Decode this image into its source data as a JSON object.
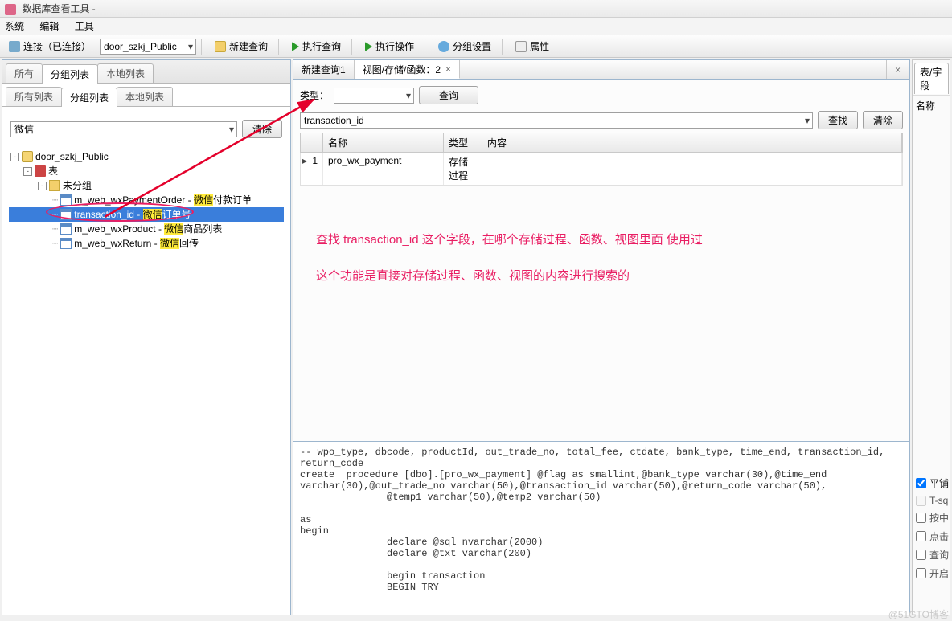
{
  "window": {
    "title": "数据库查看工具 -"
  },
  "menu": {
    "system": "系统",
    "edit": "编辑",
    "tools": "工具"
  },
  "toolbar": {
    "connect": "连接（已连接）",
    "db_selected": "door_szkj_Public",
    "new_query": "新建查询",
    "run_query": "执行查询",
    "run_op": "执行操作",
    "group_settings": "分组设置",
    "properties": "属性"
  },
  "left": {
    "top_tabs": {
      "all": "所有",
      "group": "分组列表",
      "local": "本地列表"
    },
    "inner_tabs": {
      "all": "所有列表",
      "group": "分组列表",
      "local": "本地列表"
    },
    "filter_value": "微信",
    "clear": "清除",
    "tree": {
      "db": "door_szkj_Public",
      "tables": "表",
      "ungrouped": "未分组",
      "items": [
        {
          "name": "m_web_wxPaymentOrder",
          "desc_pre": "微信",
          "desc_post": "付款订单",
          "hl": "微信"
        },
        {
          "name": "transaction_id",
          "desc_pre": "微信",
          "desc_post": "订单号",
          "hl": "微信",
          "selected": true
        },
        {
          "name": "m_web_wxProduct",
          "desc_pre": "微信",
          "desc_post": "商品列表",
          "hl": "微信"
        },
        {
          "name": "m_web_wxReturn",
          "desc_pre": "微信",
          "desc_post": "回传",
          "hl": "微信"
        }
      ]
    }
  },
  "right": {
    "tabs": {
      "t1": "新建查询1",
      "t2": "视图/存储/函数：2"
    },
    "type_label": "类型：",
    "query_btn": "查询",
    "search_value": "transaction_id",
    "find_btn": "查找",
    "clear_btn": "清除",
    "columns": {
      "name": "名称",
      "type": "类型",
      "content": "内容"
    },
    "rows": [
      {
        "idx": "1",
        "name": "pro_wx_payment",
        "type": "存储过程",
        "content": ""
      }
    ],
    "annot1": "查找 transaction_id 这个字段，在哪个存储过程、函数、视图里面 使用过",
    "annot2": "这个功能是直接对存储过程、函数、视图的内容进行搜索的",
    "sql": "-- wpo_type, dbcode, productId, out_trade_no, total_fee, ctdate, bank_type, time_end, transaction_id, return_code\ncreate  procedure [dbo].[pro_wx_payment] @flag as smallint,@bank_type varchar(30),@time_end varchar(30),@out_trade_no varchar(50),@transaction_id varchar(50),@return_code varchar(50),\n               @temp1 varchar(50),@temp2 varchar(50)\n\nas\nbegin\n               declare @sql nvarchar(2000)\n               declare @txt varchar(200)\n\n               begin transaction\n               BEGIN TRY"
  },
  "side": {
    "tab_label": "表/字段",
    "name_header": "名称",
    "opts": {
      "flat": "平铺",
      "tsq": "T-sq",
      "selmid": "按中",
      "click": "点击",
      "query": "查询",
      "open": "开启"
    }
  },
  "watermark": "@51GTO博客"
}
